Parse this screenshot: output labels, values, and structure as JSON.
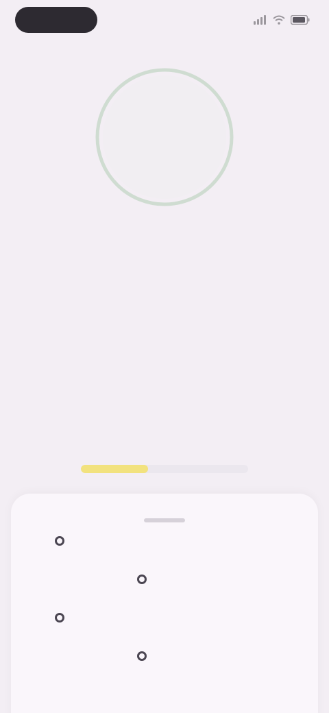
{
  "status_bar": {
    "time": "",
    "icons": [
      "signal-icon",
      "wifi-icon",
      "battery-icon"
    ]
  },
  "timer": {
    "value": "",
    "ring_color": "#c9d6cb"
  },
  "hint": {
    "text": ""
  },
  "progress": {
    "label": "",
    "fraction": 0.4,
    "fill_color": "#f2e27e"
  },
  "sheet": {
    "items": [
      {
        "label": ""
      },
      {
        "label": ""
      },
      {
        "label": ""
      },
      {
        "label": ""
      }
    ]
  },
  "colors": {
    "background": "#f3eef4",
    "sheet": "#faf6fb",
    "dark": "#2d2a31"
  }
}
